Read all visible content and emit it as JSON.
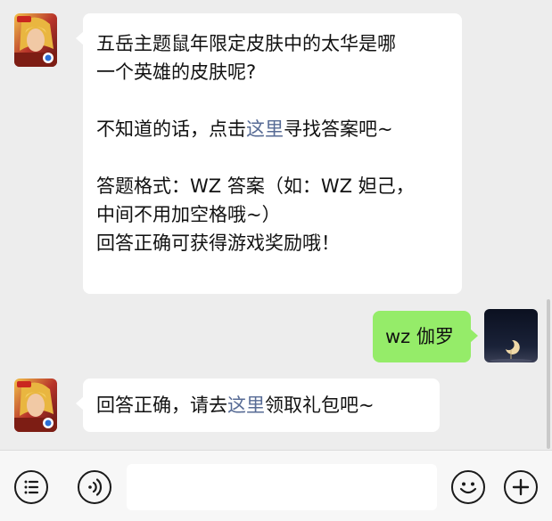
{
  "messages": [
    {
      "side": "left",
      "avatar": "game-hero-avatar",
      "lines": [
        {
          "text": "五岳主题鼠年限定皮肤中的太华是哪"
        },
        {
          "text": "一个英雄的皮肤呢?"
        },
        {
          "gap": true
        },
        {
          "parts": [
            {
              "text": "不知道的话，点击"
            },
            {
              "text": "这里",
              "link": true
            },
            {
              "text": "寻找答案吧~"
            }
          ]
        },
        {
          "gap": true
        },
        {
          "text": "答题格式：WZ 答案（如：WZ 妲己，"
        },
        {
          "text": "中间不用加空格哦~）"
        },
        {
          "text": "回答正确可获得游戏奖励哦！"
        }
      ]
    },
    {
      "side": "right",
      "avatar": "night-moon-avatar",
      "text": "wz 伽罗"
    },
    {
      "side": "left",
      "avatar": "game-hero-avatar",
      "parts": [
        {
          "text": "回答正确，请去"
        },
        {
          "text": "这里",
          "link": true
        },
        {
          "text": "领取礼包吧~"
        }
      ]
    }
  ],
  "toolbar": {
    "icons": [
      "menu-icon",
      "voice-icon",
      "emoji-icon",
      "plus-icon"
    ],
    "input_value": ""
  },
  "colors": {
    "background": "#ededed",
    "bubble_left": "#ffffff",
    "bubble_right": "#95ec69",
    "link": "#576b95"
  }
}
